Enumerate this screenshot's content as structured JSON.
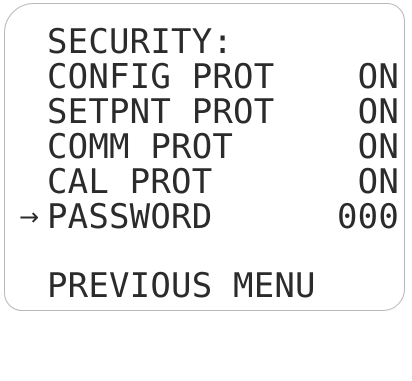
{
  "menu": {
    "title": "SECURITY:",
    "items": [
      {
        "label": "CONFIG PROT",
        "value": "ON"
      },
      {
        "label": "SETPNT PROT",
        "value": "ON"
      },
      {
        "label": "COMM PROT",
        "value": "ON"
      },
      {
        "label": "CAL PROT",
        "value": "ON"
      },
      {
        "label": "PASSWORD",
        "value": "000",
        "selected": true
      }
    ],
    "cursor_symbol": "→",
    "back_label": "PREVIOUS MENU"
  }
}
